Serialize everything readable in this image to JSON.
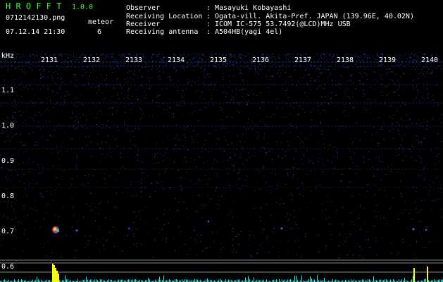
{
  "header": {
    "app_title": "H R O F F T",
    "app_version": "1.0.0",
    "file_name": "0712142130.png",
    "date_time": "07.12.14 21:30",
    "meteor_label": "meteor",
    "meteor_count": "6"
  },
  "station": {
    "observer_label": "Observer",
    "observer_value": "Masayuki Kobayashi",
    "location_label": "Receiving Location",
    "location_value": "Ogata-vill. Akita-Pref. JAPAN (139.96E, 40.02N)",
    "receiver_label": "Receiver",
    "receiver_value": "ICOM IC-575 53.7492(@LCD)MHz USB",
    "antenna_label": "Receiving antenna",
    "antenna_value": "A504HB(yagi 4el)",
    "colon": ":"
  },
  "axis": {
    "unit": "kHz",
    "freq_ticks": [
      "1.1",
      "1.0",
      "0.9",
      "0.8",
      "0.7",
      "0.6"
    ],
    "minute_ticks": [
      "2131",
      "2132",
      "2133",
      "2134",
      "2135",
      "2136",
      "2137",
      "2138",
      "2139",
      "2140"
    ]
  },
  "colors": {
    "background": "#000000",
    "title": "#33ff33",
    "text": "#ffffff",
    "noise": "#2a3ab8",
    "signal_peak": "#ffff00",
    "baseline_trace": "#00ffff"
  }
}
